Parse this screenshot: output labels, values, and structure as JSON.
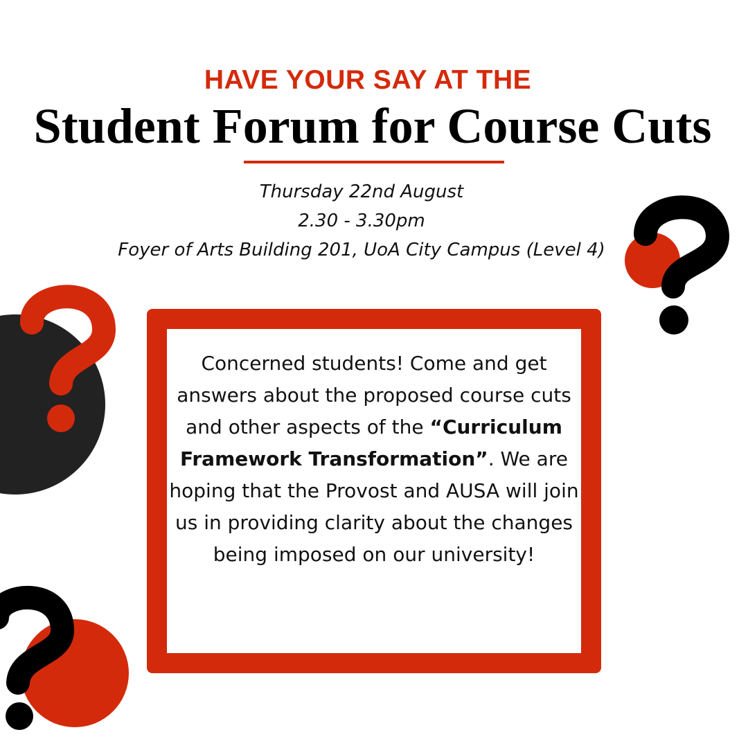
{
  "header": {
    "kicker": "HAVE YOUR SAY AT THE",
    "title": "Student Forum for Course Cuts"
  },
  "event": {
    "date": "Thursday 22nd August",
    "time": "2.30 - 3.30pm",
    "location": "Foyer of Arts Building 201, UoA City Campus (Level 4)"
  },
  "message": {
    "intro": "Concerned students! Come and get answers about the proposed course cuts and other aspects of the",
    "highlight": "“Curriculum Framework Transformation”",
    "outro": ". We are hoping that the Provost and AUSA will join us in providing clarity about the changes being imposed on our university!"
  },
  "colors": {
    "accent": "#d42a0c",
    "dark": "#222222",
    "text": "#000000",
    "background": "#ffffff"
  },
  "decorations": {
    "icon": "question-mark-icon"
  }
}
